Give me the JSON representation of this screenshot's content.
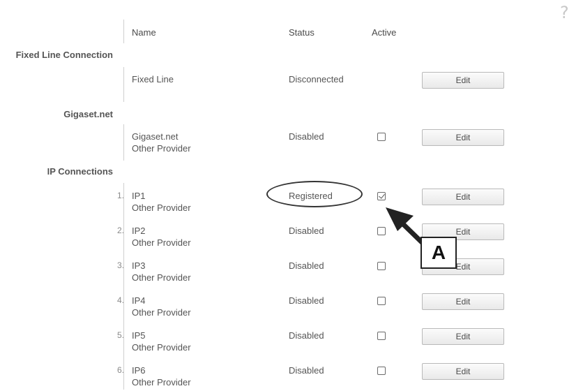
{
  "help_symbol": "?",
  "columns": {
    "name": "Name",
    "status": "Status",
    "active": "Active"
  },
  "sections": {
    "fixed": "Fixed Line Connection",
    "gigaset": "Gigaset.net",
    "ip": "IP Connections"
  },
  "rows": [
    {
      "index": "",
      "name": "Fixed Line",
      "provider": "",
      "status": "Disconnected",
      "has_checkbox": false,
      "checked": false,
      "edit": "Edit"
    },
    {
      "index": "",
      "name": "Gigaset.net",
      "provider": "Other Provider",
      "status": "Disabled",
      "has_checkbox": true,
      "checked": false,
      "edit": "Edit"
    },
    {
      "index": "1.",
      "name": "IP1",
      "provider": "Other Provider",
      "status": "Registered",
      "has_checkbox": true,
      "checked": true,
      "edit": "Edit"
    },
    {
      "index": "2.",
      "name": "IP2",
      "provider": "Other Provider",
      "status": "Disabled",
      "has_checkbox": true,
      "checked": false,
      "edit": "Edit"
    },
    {
      "index": "3.",
      "name": "IP3",
      "provider": "Other Provider",
      "status": "Disabled",
      "has_checkbox": true,
      "checked": false,
      "edit": "Edit"
    },
    {
      "index": "4.",
      "name": "IP4",
      "provider": "Other Provider",
      "status": "Disabled",
      "has_checkbox": true,
      "checked": false,
      "edit": "Edit"
    },
    {
      "index": "5.",
      "name": "IP5",
      "provider": "Other Provider",
      "status": "Disabled",
      "has_checkbox": true,
      "checked": false,
      "edit": "Edit"
    },
    {
      "index": "6.",
      "name": "IP6",
      "provider": "Other Provider",
      "status": "Disabled",
      "has_checkbox": true,
      "checked": false,
      "edit": "Edit"
    }
  ],
  "annotation": {
    "callout_label": "A"
  }
}
